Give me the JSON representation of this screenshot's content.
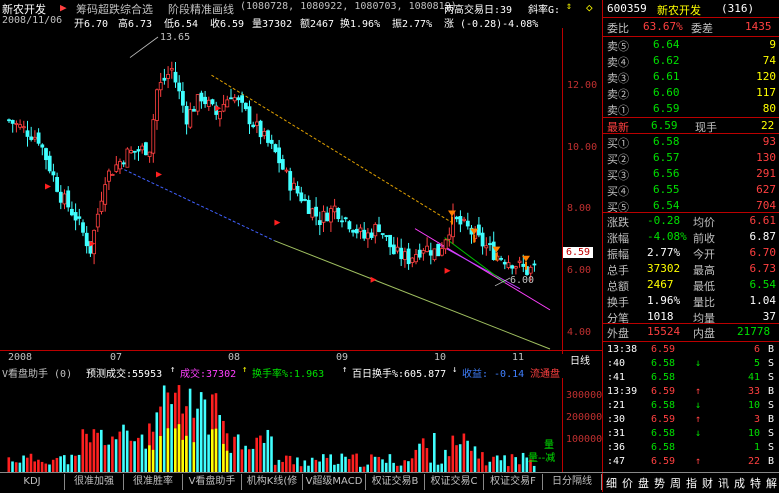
{
  "header": {
    "stock_name": "新农开发",
    "indicator_name": "筹码超跌综合选",
    "template": "阶段精准画线",
    "params": "(1080728, 1080922, 1080703, 1080819)",
    "exchange_days_label": "两高交易日:39",
    "slope_label": "斜率G:",
    "date": "2008/11/06",
    "open": "开6.70",
    "high": "高6.73",
    "low": "低6.54",
    "close": "收6.59",
    "volume": "量37302",
    "amount": "额2467",
    "turnover": "换1.96%",
    "amplitude": "振2.77%",
    "change": "涨 (-0.28)-4.08%"
  },
  "main_chart": {
    "high_label": "13.65",
    "low_label": "6.00",
    "current_price_tag": "6.59",
    "price_ticks": [
      "12.00",
      "10.00",
      "8.00",
      "6.00",
      "4.00"
    ],
    "date_ticks": [
      "2008",
      "07",
      "08",
      "09",
      "10",
      "11"
    ],
    "period_label": "日线"
  },
  "chart_data": {
    "type": "candlestick",
    "title": "新农开发",
    "x": [
      "2008-06",
      "2008-07",
      "2008-08",
      "2008-09",
      "2008-10",
      "2008-11"
    ],
    "ylim": [
      3.8,
      14.5
    ],
    "key_values": {
      "max": 13.65,
      "min": 6.0,
      "last": 6.59
    },
    "volume_ylim": [
      0,
      400000
    ],
    "volume_ticks": [
      300000,
      200000,
      100000
    ]
  },
  "volume": {
    "indicator": "V看盘助手 (0)",
    "forecast": "预测成交:55953",
    "vol": "成交:37302",
    "turnover_rate": "换手率%:1.963",
    "hundred_day": "百日换手%:605.877",
    "gain": "收益: -0.14",
    "flow": "流通盘",
    "ticks": [
      "300000",
      "200000",
      "100000"
    ],
    "legend_up": "量",
    "legend_down": "量--减"
  },
  "tabs": [
    "KDJ",
    "很准加强",
    "很准胜率",
    "V看盘助手",
    "机构K线(修",
    "V超级MACD",
    "权证交易B",
    "权证交易C",
    "权证交易F",
    "日分隔线"
  ],
  "quote": {
    "code": "600359",
    "name": "新农开发",
    "count": "(316)",
    "weibi_label": "委比",
    "weibi": "63.67%",
    "weicha_label": "委差",
    "weicha": "1435",
    "sells": [
      {
        "label": "卖⑤",
        "price": "6.64",
        "vol": "9"
      },
      {
        "label": "卖④",
        "price": "6.62",
        "vol": "74"
      },
      {
        "label": "卖③",
        "price": "6.61",
        "vol": "120"
      },
      {
        "label": "卖②",
        "price": "6.60",
        "vol": "117"
      },
      {
        "label": "卖①",
        "price": "6.59",
        "vol": "80"
      }
    ],
    "latest_label": "最新",
    "latest": "6.59",
    "xianshou_label": "现手",
    "xianshou": "22",
    "buys": [
      {
        "label": "买①",
        "price": "6.58",
        "vol": "93"
      },
      {
        "label": "买②",
        "price": "6.57",
        "vol": "130"
      },
      {
        "label": "买③",
        "price": "6.56",
        "vol": "291"
      },
      {
        "label": "买④",
        "price": "6.55",
        "vol": "627"
      },
      {
        "label": "买⑤",
        "price": "6.54",
        "vol": "704"
      }
    ],
    "stats": [
      {
        "l1": "涨跌",
        "v1": "-0.28",
        "l2": "均价",
        "v2": "6.61"
      },
      {
        "l1": "涨幅",
        "v1": "-4.08%",
        "l2": "前收",
        "v2": "6.87"
      },
      {
        "l1": "振幅",
        "v1": "2.77%",
        "l2": "今开",
        "v2": "6.70"
      },
      {
        "l1": "总手",
        "v1": "37302",
        "l2": "最高",
        "v2": "6.73"
      },
      {
        "l1": "总额",
        "v1": "2467",
        "l2": "最低",
        "v2": "6.54"
      },
      {
        "l1": "换手",
        "v1": "1.96%",
        "l2": "量比",
        "v2": "1.04"
      },
      {
        "l1": "分笔",
        "v1": "1018",
        "l2": "均量",
        "v2": "37"
      }
    ],
    "outer_label": "外盘",
    "outer": "15524",
    "inner_label": "内盘",
    "inner": "21778"
  },
  "ticks": [
    {
      "time": "13:38",
      "price": "6.59",
      "arrow": "",
      "vol": "6",
      "side": "B"
    },
    {
      "time": ":40",
      "price": "6.58",
      "arrow": "↓",
      "vol": "5",
      "side": "S"
    },
    {
      "time": ":41",
      "price": "6.58",
      "arrow": "",
      "vol": "41",
      "side": "S"
    },
    {
      "time": "13:39",
      "price": "6.59",
      "arrow": "↑",
      "vol": "33",
      "side": "B"
    },
    {
      "time": ":21",
      "price": "6.58",
      "arrow": "↓",
      "vol": "10",
      "side": "S"
    },
    {
      "time": ":30",
      "price": "6.59",
      "arrow": "↑",
      "vol": "3",
      "side": "B"
    },
    {
      "time": ":31",
      "price": "6.58",
      "arrow": "↓",
      "vol": "10",
      "side": "S"
    },
    {
      "time": ":36",
      "price": "6.58",
      "arrow": "",
      "vol": "1",
      "side": "S"
    },
    {
      "time": ":47",
      "price": "6.59",
      "arrow": "↑",
      "vol": "22",
      "side": "B"
    }
  ],
  "side_tabs": [
    "细",
    "价",
    "盘",
    "势",
    "周",
    "指",
    "财",
    "讯",
    "成",
    "特",
    "解"
  ],
  "colors": {
    "up": "#ff4040",
    "down": "#40ffff",
    "axis": "#b00000",
    "yellow": "#ffff00"
  }
}
